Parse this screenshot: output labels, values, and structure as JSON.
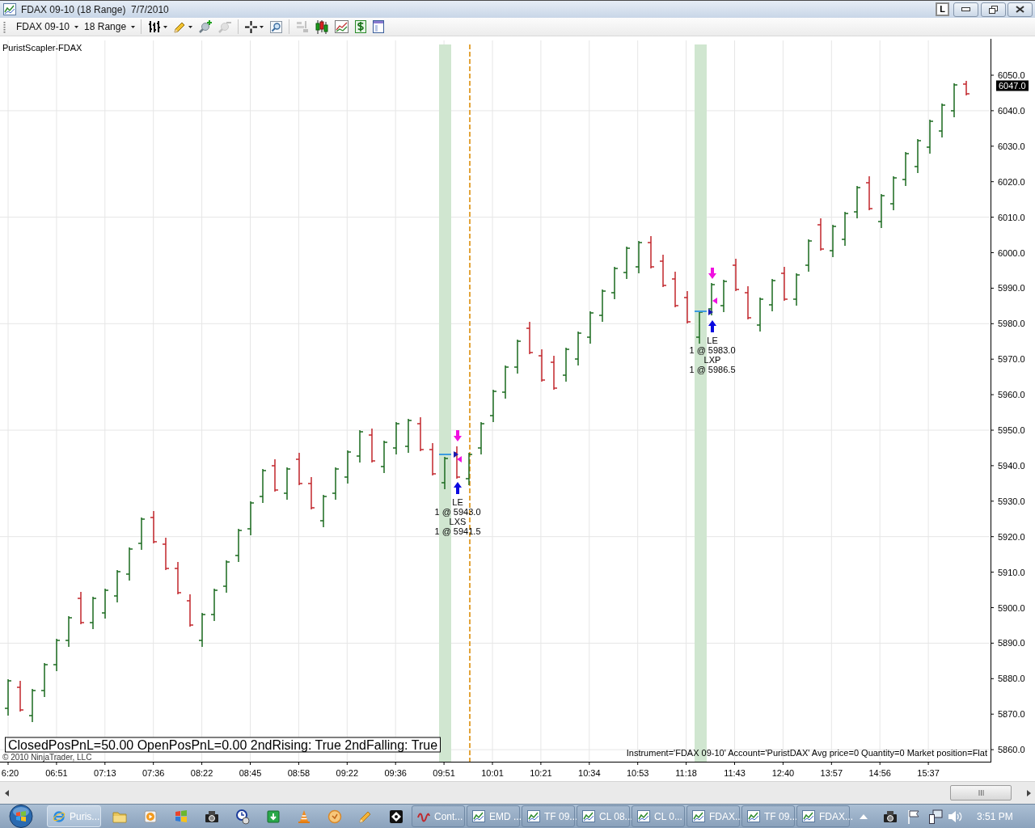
{
  "window": {
    "title": "FDAX 09-10 (18 Range)  7/7/2010",
    "link_button": "L"
  },
  "toolbar": {
    "instrument": "FDAX 09-10",
    "period": "18 Range",
    "tool_groups": [
      [
        {
          "kind": "bars",
          "disabled": false
        },
        {
          "kind": "pencil",
          "disabled": false
        },
        {
          "kind": "add",
          "disabled": false
        },
        {
          "kind": "remove",
          "disabled": true
        }
      ],
      [
        {
          "kind": "crosshair",
          "disabled": false
        },
        {
          "kind": "zoom",
          "disabled": false
        }
      ],
      [
        {
          "kind": "layout",
          "disabled": true
        },
        {
          "kind": "candles",
          "disabled": false
        },
        {
          "kind": "chart",
          "disabled": false
        },
        {
          "kind": "dollar",
          "disabled": false
        },
        {
          "kind": "window",
          "disabled": false
        }
      ]
    ]
  },
  "chart": {
    "indicator_label": "PuristScapler-FDAX",
    "price_labels": [
      "6050.0",
      "6040.0",
      "6030.0",
      "6020.0",
      "6010.0",
      "6000.0",
      "5990.0",
      "5980.0",
      "5970.0",
      "5960.0",
      "5950.0",
      "5940.0",
      "5930.0",
      "5920.0",
      "5910.0",
      "5900.0",
      "5890.0",
      "5880.0",
      "5870.0",
      "5860.0"
    ],
    "current_price": "6047.0",
    "time_labels": [
      "6:20",
      "06:51",
      "07:13",
      "07:36",
      "08:22",
      "08:45",
      "08:58",
      "09:22",
      "09:36",
      "09:51",
      "10:01",
      "10:21",
      "10:34",
      "10:53",
      "11:18",
      "11:43",
      "12:40",
      "13:57",
      "14:56",
      "15:37"
    ],
    "trades": [
      {
        "entry": "LE",
        "entry_fill": "1 @ 5943.0",
        "exit": "LXS",
        "exit_fill": "1 @ 5941.5"
      },
      {
        "entry": "LE",
        "entry_fill": "1 @ 5983.0",
        "exit": "LXP",
        "exit_fill": "1 @ 5986.5"
      }
    ],
    "pnl_summary": "ClosedPosPnL=50.00 OpenPosPnL=0.00 2ndRising: True 2ndFalling: True",
    "copyright": "© 2010 NinjaTrader, LLC",
    "position_summary": "Instrument='FDAX 09-10' Account='PuristDAX' Avg price=0 Quantity=0 Market position=Flat"
  },
  "taskbar": {
    "windows": [
      {
        "label": "Puris...",
        "kind": "browser",
        "selected": true
      },
      {
        "label": "Cont...",
        "kind": "app",
        "selected": false
      },
      {
        "label": "EMD ...",
        "kind": "chart",
        "selected": false
      },
      {
        "label": "TF 09...",
        "kind": "chart",
        "selected": false
      },
      {
        "label": "CL 08...",
        "kind": "chart",
        "selected": false
      },
      {
        "label": "CL 0...",
        "kind": "chart",
        "selected": false
      },
      {
        "label": "FDAX...",
        "kind": "chart",
        "selected": false
      },
      {
        "label": "TF 09...",
        "kind": "chart",
        "selected": false
      },
      {
        "label": "FDAX...",
        "kind": "chart",
        "selected": false
      }
    ],
    "clock": "3:51 PM"
  }
}
